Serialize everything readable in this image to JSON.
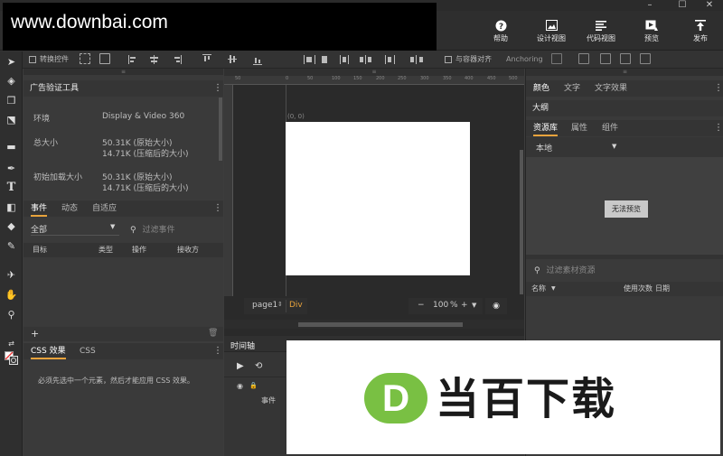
{
  "watermark": "www.downbai.com",
  "window_controls": {
    "minimize": "–",
    "maximize": "☐",
    "close": "✕"
  },
  "header": {
    "buttons": [
      {
        "label": "帮助",
        "icon": "help-icon"
      },
      {
        "label": "设计视图",
        "icon": "image-icon"
      },
      {
        "label": "代码视图",
        "icon": "code-lines-icon"
      },
      {
        "label": "预览",
        "icon": "play-icon"
      },
      {
        "label": "发布",
        "icon": "upload-icon"
      }
    ]
  },
  "toolbar2": {
    "transform_controls": "转换控件",
    "fit_container": "与容器对齐",
    "anchoring": "Anchoring"
  },
  "left_panel": {
    "ad_tool": {
      "title": "广告验证工具",
      "rows": [
        {
          "label": "环境",
          "value1": "Display & Video 360",
          "value2": ""
        },
        {
          "label": "总大小",
          "value1": "50.31K (原始大小)",
          "value2": "14.71K (压缩后的大小)"
        },
        {
          "label": "初始加载大小",
          "value1": "50.31K (原始大小)",
          "value2": "14.71K (压缩后的大小)"
        }
      ]
    },
    "events": {
      "tabs": [
        "事件",
        "动态",
        "自适应"
      ],
      "filter_select": "全部",
      "filter_placeholder": "过滤事件",
      "columns": [
        "目标",
        "类型",
        "操作",
        "接收方"
      ]
    },
    "css": {
      "tabs": [
        "CSS 效果",
        "CSS"
      ],
      "message": "必须先选中一个元素，然后才能应用 CSS 效果。"
    }
  },
  "canvas": {
    "origin_label": "(0, 0)",
    "ruler_ticks": [
      "50",
      "0",
      "50",
      "100",
      "150",
      "200",
      "250",
      "300",
      "350",
      "400",
      "450",
      "500"
    ],
    "page_select": "page1",
    "element_label": "Div",
    "zoom": "100",
    "zoom_unit": "%",
    "zoom_minus": "−",
    "zoom_plus": "+"
  },
  "timeline": {
    "title": "时间轴",
    "events_label": "事件"
  },
  "right_panel": {
    "top_tabs": [
      "颜色",
      "文字",
      "文字效果"
    ],
    "outline": "大纲",
    "library_tabs": [
      "资源库",
      "属性",
      "组件"
    ],
    "location_select": "本地",
    "no_preview": "无法预览",
    "filter_placeholder": "过滤素材资源",
    "columns": [
      "名称",
      "使用次数",
      "日期"
    ]
  },
  "logo": {
    "mark": "D",
    "text": "当百下载",
    "mark_color": "#79c043"
  }
}
